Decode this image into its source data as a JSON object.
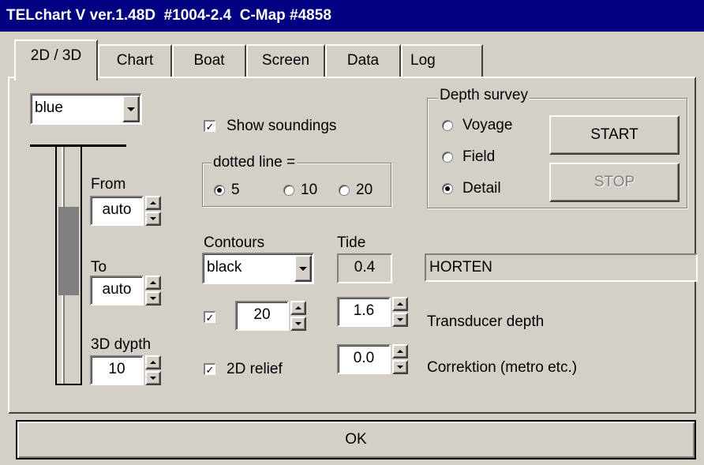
{
  "window": {
    "title": "TELchart V ver.1.48D  #1004-2.4  C-Map #4858"
  },
  "tabs": [
    {
      "label": "2D / 3D",
      "active": true
    },
    {
      "label": "Chart"
    },
    {
      "label": "Boat"
    },
    {
      "label": "Screen"
    },
    {
      "label": "Data"
    },
    {
      "label": "Log"
    }
  ],
  "color_scheme": {
    "selected": "blue"
  },
  "depth_scale": {
    "from_label": "From",
    "from_value": "auto",
    "to_label": "To",
    "to_value": "auto",
    "dypth_label": "3D dypth",
    "dypth_value": "10"
  },
  "soundings": {
    "label": "Show soundings",
    "checked": true
  },
  "dotted_line": {
    "legend": "dotted line =",
    "options": [
      "5",
      "10",
      "20"
    ],
    "selected": "5"
  },
  "contours": {
    "label": "Contours",
    "color": "black",
    "enabled": true,
    "interval": "20"
  },
  "relief": {
    "label": "2D relief",
    "checked": true
  },
  "tide": {
    "label": "Tide",
    "value": "0.4",
    "station": "HORTEN"
  },
  "transducer": {
    "value": "1.6",
    "label": "Transducer depth"
  },
  "correction": {
    "value": "0.0",
    "label": "Correktion (metro etc.)"
  },
  "depth_survey": {
    "legend": "Depth survey",
    "options": [
      "Voyage",
      "Field",
      "Detail"
    ],
    "selected": "Detail",
    "start_label": "START",
    "stop_label": "STOP"
  },
  "ok_label": "OK",
  "colors": {
    "titlebar": "#000080",
    "face": "#d4d0c8",
    "slider_thumb": "#808080"
  }
}
